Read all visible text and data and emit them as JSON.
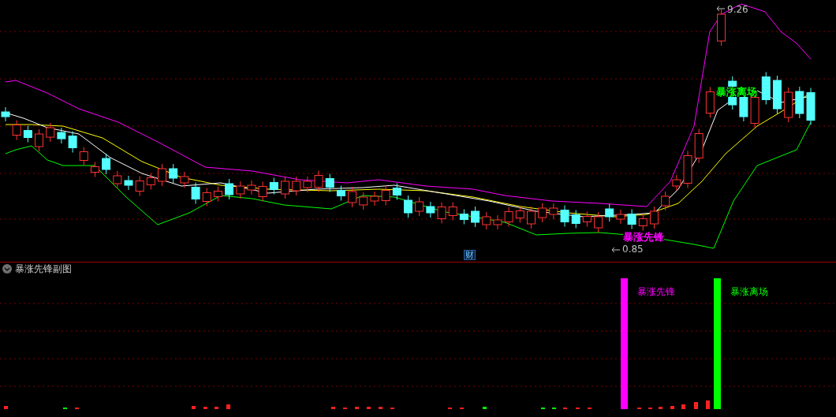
{
  "main_chart": {
    "high_label": "9.26",
    "low_label": "0.85",
    "signals": [
      {
        "text": "暴涨先锋",
        "color": "#ff00ff"
      },
      {
        "text": "暴涨离场",
        "color": "#00ff00"
      }
    ],
    "marker": "财"
  },
  "sub_chart": {
    "title": "暴涨先锋副图",
    "signals": [
      {
        "label": "暴涨先锋",
        "color": "#ff00ff"
      },
      {
        "label": "暴涨离场",
        "color": "#00ff00"
      }
    ]
  }
}
